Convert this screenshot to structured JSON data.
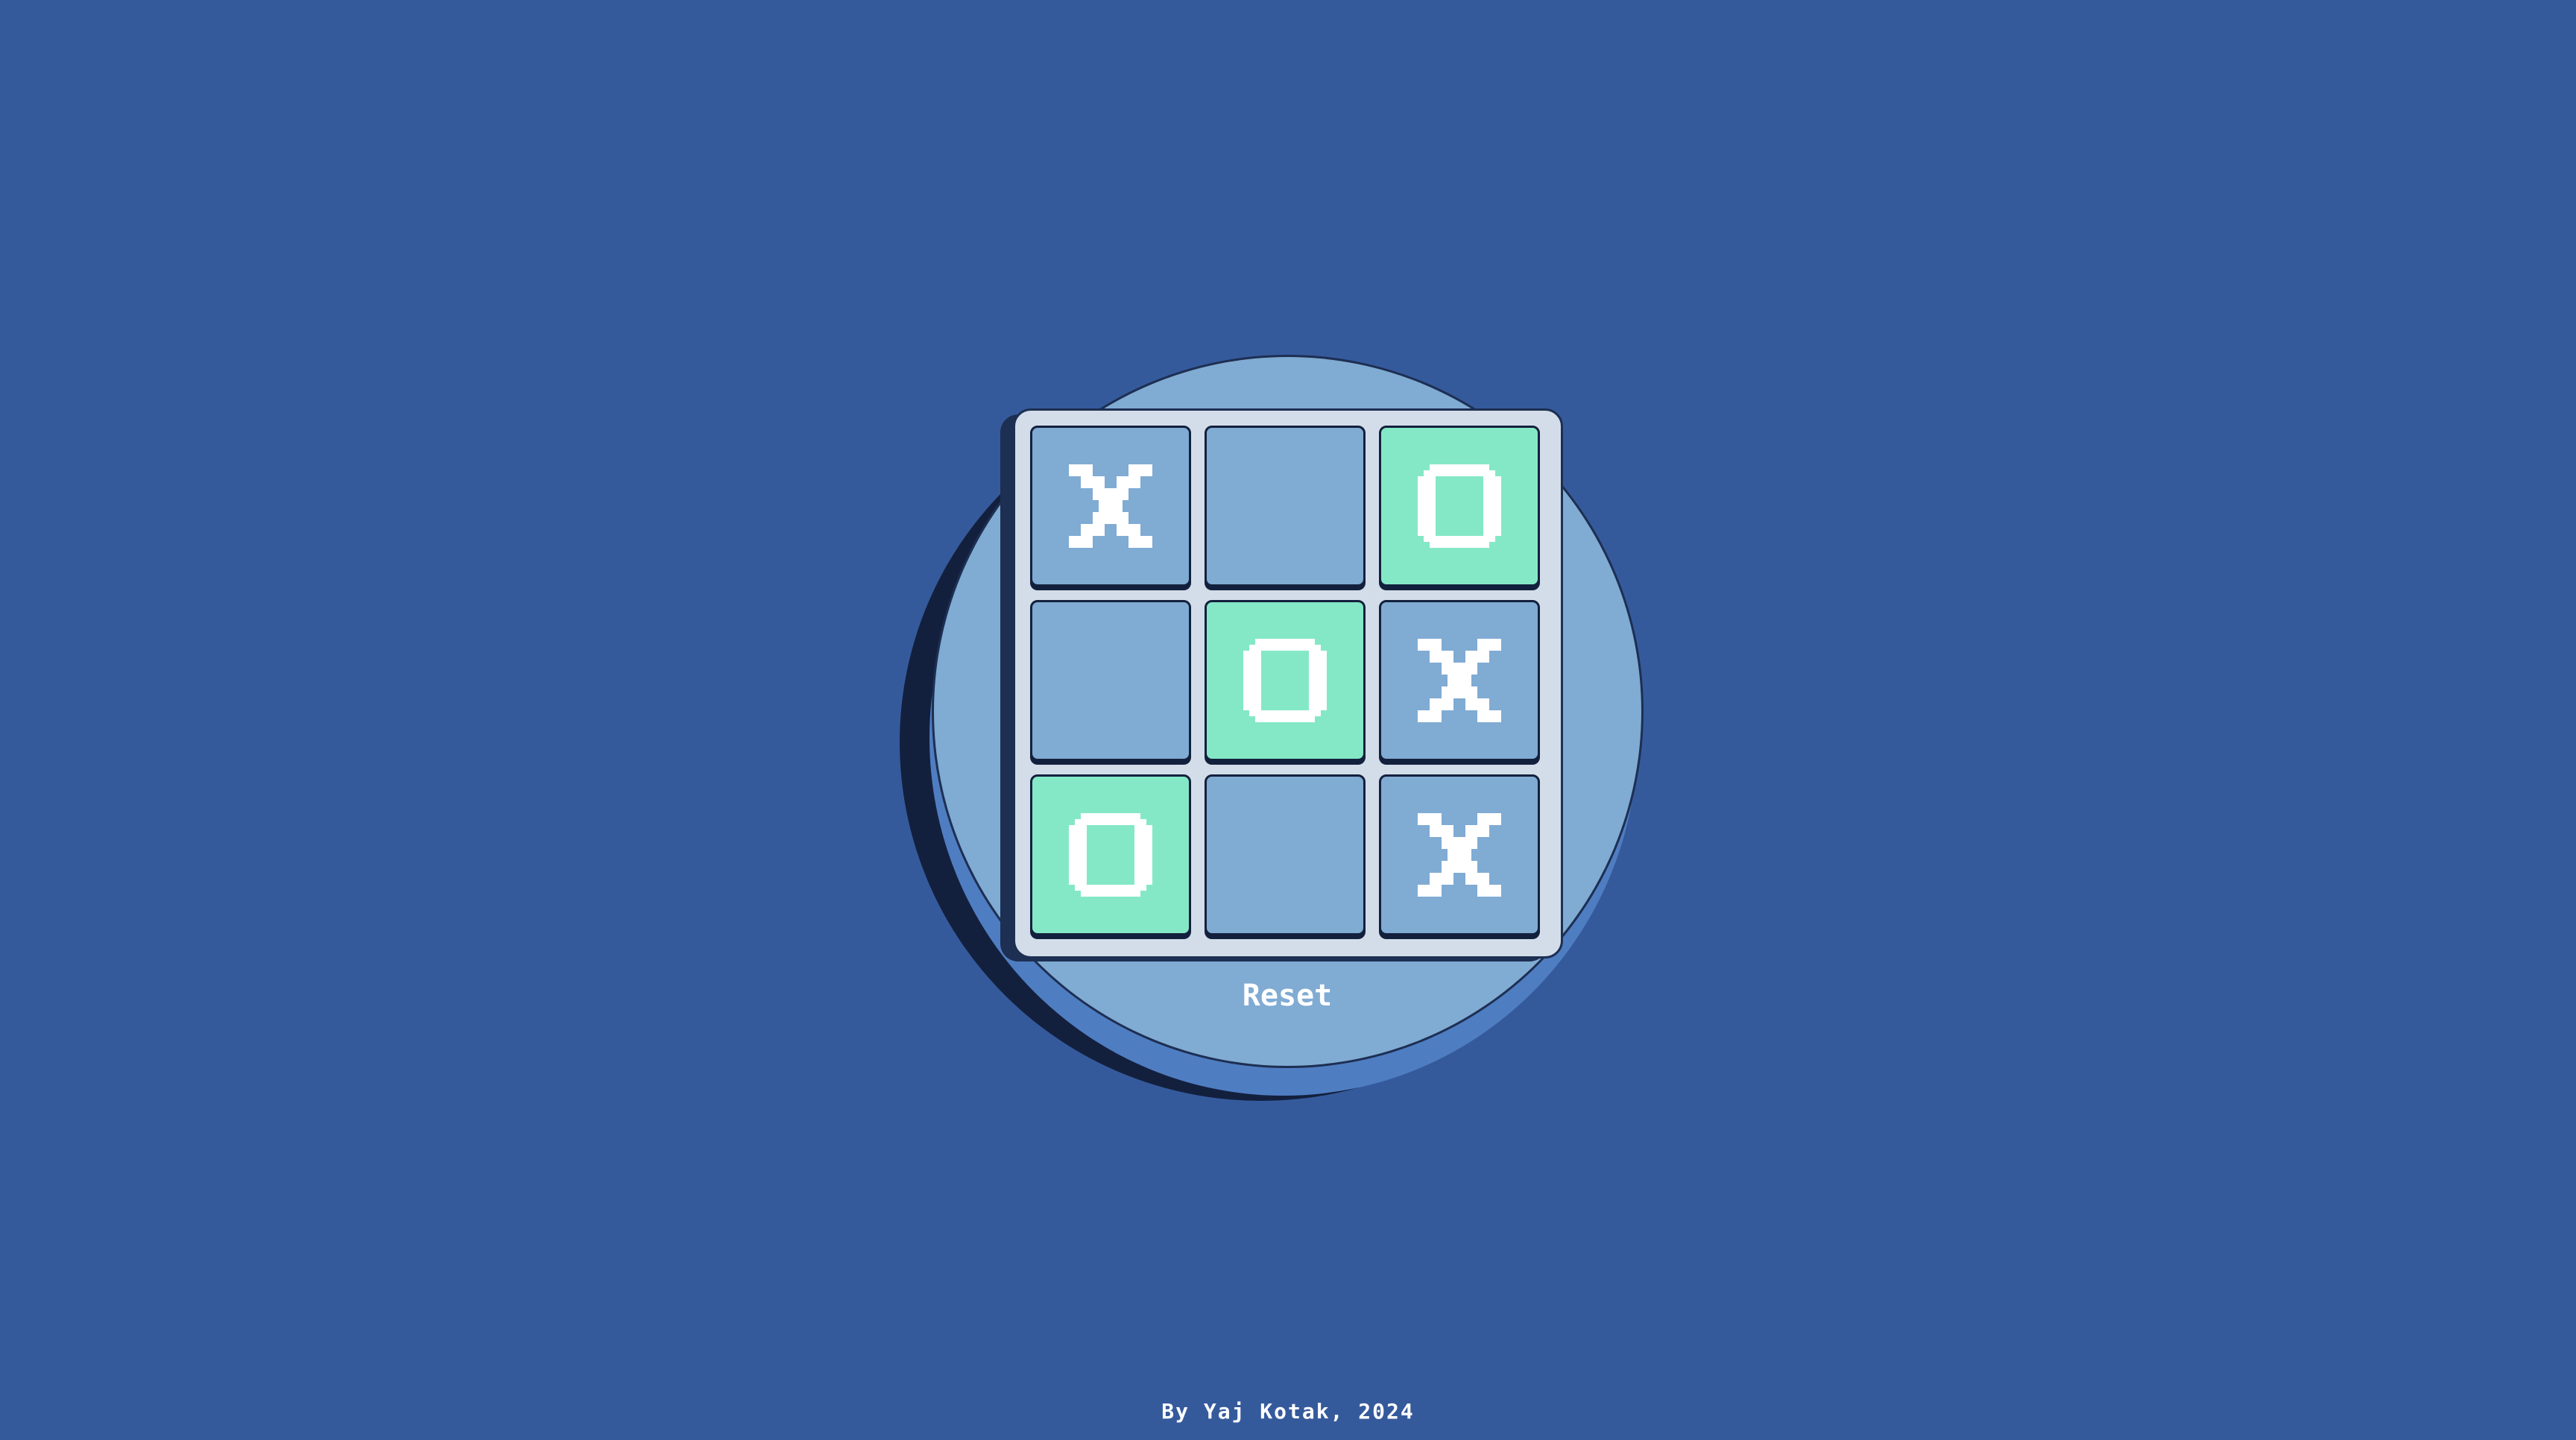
{
  "board": {
    "cells": [
      "X",
      "",
      "O",
      "",
      "O",
      "X",
      "O",
      "",
      "X"
    ]
  },
  "controls": {
    "reset_label": "Reset"
  },
  "footer": {
    "credit": "By Yaj Kotak, 2024"
  },
  "colors": {
    "background": "#355a9c",
    "disc": "#80abd3",
    "board": "#d3dde9",
    "cell_empty": "#80abd3",
    "cell_o": "#84e8c6",
    "mark": "#ffffff",
    "outline": "#13203d"
  },
  "icons": {
    "x_mark": "pixel-x-icon",
    "o_mark": "pixel-o-icon"
  }
}
